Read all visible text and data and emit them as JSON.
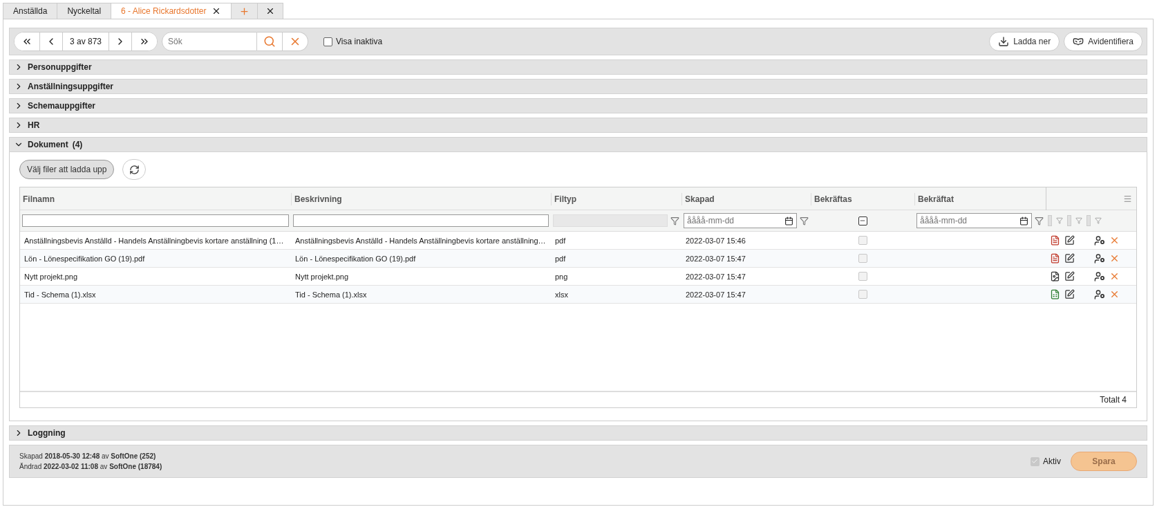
{
  "tabs": [
    {
      "label": "Anställda",
      "selected": false,
      "closable": false
    },
    {
      "label": "Nyckeltal",
      "selected": false,
      "closable": false
    },
    {
      "label": "6 - Alice Rickardsdotter",
      "selected": true,
      "closable": true
    }
  ],
  "toolbar": {
    "position": "3 av 873",
    "search": {
      "placeholder": "Sök"
    },
    "show_inactive": {
      "label": "Visa inaktiva",
      "checked": false
    },
    "buttons": [
      {
        "label": "Ladda ner",
        "kind": "download"
      },
      {
        "label": "Avidentifiera",
        "kind": "anonymize"
      }
    ]
  },
  "sections": [
    {
      "title": "Personuppgifter",
      "expanded": false
    },
    {
      "title": "Anställningsuppgifter",
      "expanded": false
    },
    {
      "title": "Schemauppgifter",
      "expanded": false
    },
    {
      "title": "HR",
      "expanded": false
    },
    {
      "title": "Dokument",
      "count": "(4)",
      "expanded": true
    }
  ],
  "documents": {
    "upload_button": "Välj filer att ladda upp",
    "columns": [
      "Filnamn",
      "Beskrivning",
      "Filtyp",
      "Skapad",
      "Bekräftas",
      "Bekräftat"
    ],
    "created_filter": {
      "placeholder": "åååå-mm-dd"
    },
    "confirm_filter": {
      "indeterminate": true
    },
    "confirmed_filter": {
      "placeholder": "åååå-mm-dd"
    },
    "rows": [
      {
        "filename": "Anställningsbevis Anställd - Handels Anställningbevis kortare anställning (1…",
        "description": "Anställningsbevis Anställd - Handels Anställningbevis kortare anställning…",
        "filetype": "pdf",
        "kind": "pdf",
        "created": "2022-03-07 15:46",
        "confirm": false
      },
      {
        "filename": "Lön - Lönespecifikation GO (19).pdf",
        "description": "Lön - Lönespecifikation GO (19).pdf",
        "filetype": "pdf",
        "kind": "pdf",
        "created": "2022-03-07 15:47",
        "confirm": false
      },
      {
        "filename": "Nytt projekt.png",
        "description": "Nytt projekt.png",
        "filetype": "png",
        "kind": "image",
        "created": "2022-03-07 15:47",
        "confirm": false
      },
      {
        "filename": "Tid - Schema (1).xlsx",
        "description": "Tid - Schema (1).xlsx",
        "filetype": "xlsx",
        "kind": "spreadsheet",
        "created": "2022-03-07 15:47",
        "confirm": false
      }
    ],
    "total": "Totalt 4"
  },
  "logging": {
    "title": "Loggning",
    "expanded": false
  },
  "footer": {
    "lines": [
      "Skapad **2018-05-30 12:48** av **SoftOne (252)**",
      "Ändrad **2022-03-02 11:08** av **SoftOne (18784)**"
    ],
    "active": {
      "label": "Aktiv",
      "checked": true
    },
    "save": {
      "label": "Spara",
      "disabled": true
    }
  }
}
